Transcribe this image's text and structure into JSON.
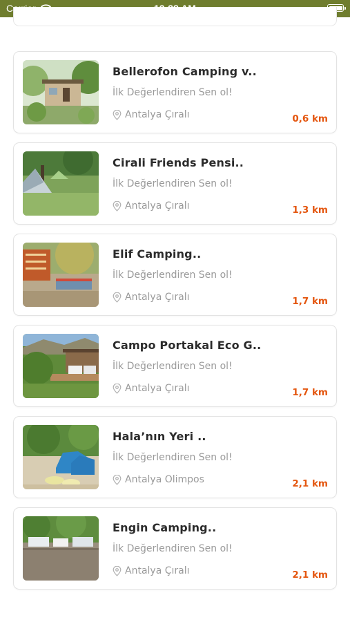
{
  "status_bar": {
    "carrier": "Carrier",
    "time": "12:38 AM"
  },
  "colors": {
    "status_bar_bg": "#6f7d2e",
    "distance_accent": "#e4560f",
    "muted_text": "#9a9a9a"
  },
  "listings": [
    {
      "title": "Bellerofon Camping v..",
      "rating_prompt": "İlk Değerlendiren Sen ol!",
      "location": "Antalya Çıralı",
      "distance": "0,6 km"
    },
    {
      "title": "Cirali Friends Pensi..",
      "rating_prompt": "İlk Değerlendiren Sen ol!",
      "location": "Antalya Çıralı",
      "distance": "1,3 km"
    },
    {
      "title": "Elif Camping..",
      "rating_prompt": "İlk Değerlendiren Sen ol!",
      "location": "Antalya Çıralı",
      "distance": "1,7 km"
    },
    {
      "title": "Campo Portakal Eco G..",
      "rating_prompt": "İlk Değerlendiren Sen ol!",
      "location": "Antalya Çıralı",
      "distance": "1,7 km"
    },
    {
      "title": "Hala’nın Yeri ..",
      "rating_prompt": "İlk Değerlendiren Sen ol!",
      "location": "Antalya Olimpos",
      "distance": "2,1 km"
    },
    {
      "title": "Engin Camping..",
      "rating_prompt": "İlk Değerlendiren Sen ol!",
      "location": "Antalya Çıralı",
      "distance": "2,1 km"
    }
  ]
}
